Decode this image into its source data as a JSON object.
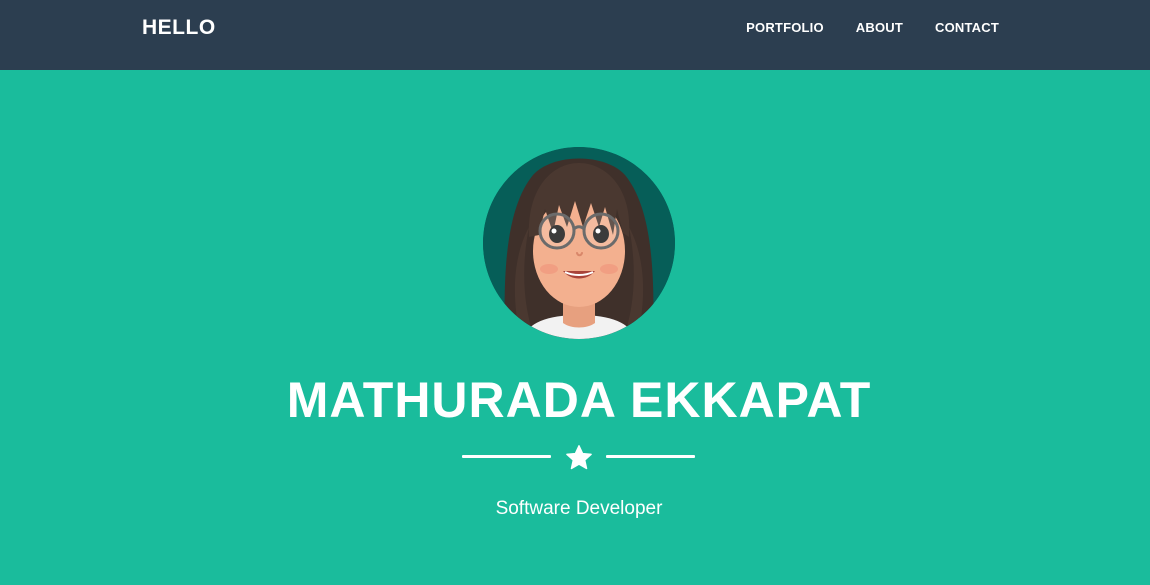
{
  "navbar": {
    "brand": "HELLO",
    "links": [
      {
        "label": "PORTFOLIO"
      },
      {
        "label": "ABOUT"
      },
      {
        "label": "CONTACT"
      }
    ]
  },
  "masthead": {
    "name": "MATHURADA EKKAPAT",
    "subtitle": "Software Developer",
    "divider_icon": "star-icon"
  },
  "colors": {
    "navbar_bg": "#2c3e50",
    "masthead_bg": "#1abc9c",
    "avatar_bg": "#065e58",
    "text": "#ffffff"
  }
}
